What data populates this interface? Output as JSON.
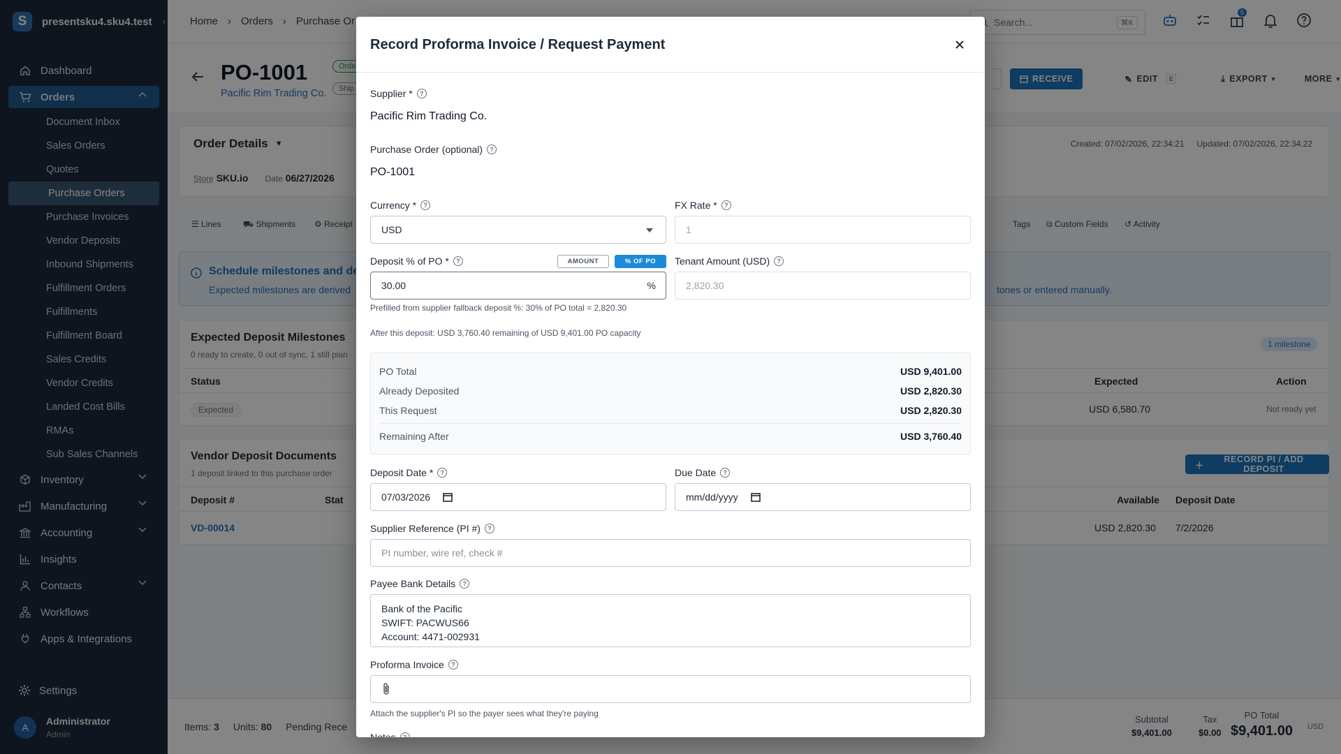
{
  "app": {
    "workspace": "presentsku4.sku4.test"
  },
  "sidebar": {
    "items": [
      {
        "label": "Dashboard"
      },
      {
        "label": "Orders"
      },
      {
        "label": "Inventory"
      },
      {
        "label": "Manufacturing"
      },
      {
        "label": "Accounting"
      },
      {
        "label": "Insights"
      },
      {
        "label": "Contacts"
      },
      {
        "label": "Workflows"
      },
      {
        "label": "Apps & Integrations"
      }
    ],
    "orders_sub": [
      "Document Inbox",
      "Sales Orders",
      "Quotes",
      "Purchase Orders",
      "Purchase Invoices",
      "Vendor Deposits",
      "Inbound Shipments",
      "Fulfillment Orders",
      "Fulfillments",
      "Fulfillment Board",
      "Sales Credits",
      "Vendor Credits",
      "Landed Cost Bills",
      "RMAs",
      "Sub Sales Channels"
    ],
    "settings": "Settings",
    "user": {
      "initial": "A",
      "name": "Administrator",
      "role": "Admin"
    }
  },
  "topbar": {
    "breadcrumbs": [
      "Home",
      "Orders",
      "Purchase Or"
    ],
    "search_placeholder": "Search...",
    "search_shortcut": "⌘K",
    "gift_badge": "5"
  },
  "page": {
    "title": "PO-1001",
    "supplier_link": "Pacific Rim Trading Co.",
    "status_chips": [
      "Orde",
      "Ship"
    ],
    "actions": {
      "receive": "RECEIVE",
      "edit": "EDIT",
      "edit_key": "E",
      "export": "EXPORT",
      "more": "MORE"
    },
    "order_details": {
      "heading": "Order Details",
      "created": "Created: 07/02/2026, 22:34:21",
      "updated": "Updated: 07/02/2026, 22:34:22",
      "store_label": "Store",
      "store_value": "SKU.io",
      "date_label": "Date",
      "date_value": "06/27/2026"
    },
    "tabs": [
      "Lines",
      "Shipments",
      "Receipt",
      "Tags",
      "Custom Fields",
      "Activity"
    ],
    "banner": {
      "title": "Schedule milestones and dep",
      "text": "Expected milestones are derived",
      "text_right": "tones or entered manually."
    },
    "milestones": {
      "heading": "Expected Deposit Milestones",
      "sub": "0 ready to create, 0 out of sync, 1 still plan",
      "badge": "1 milestone",
      "col_status": "Status",
      "col_expected": "Expected",
      "col_action": "Action",
      "row_status": "Expected",
      "row_expected": "USD 6,580.70",
      "row_action": "Not ready yet"
    },
    "deposits": {
      "heading": "Vendor Deposit Documents",
      "sub": "1 deposit linked to this purchase order",
      "button": "RECORD PI / ADD DEPOSIT",
      "col_number": "Deposit #",
      "col_status": "Stat",
      "col_available": "Available",
      "col_date": "Deposit Date",
      "row_number": "VD-00014",
      "row_available": "USD 2,820.30",
      "row_date": "7/2/2026"
    },
    "footer": {
      "items_label": "Items:",
      "items_value": "3",
      "units_label": "Units:",
      "units_value": "80",
      "pending_label": "Pending Rece",
      "subtotal_label": "Subtotal",
      "subtotal_value": "$9,401.00",
      "tax_label": "Tax",
      "tax_value": "$0.00",
      "po_total_label": "PO Total",
      "po_total_value": "$9,401.00",
      "currency": "USD"
    }
  },
  "modal": {
    "title": "Record Proforma Invoice / Request Payment",
    "supplier_label": "Supplier *",
    "supplier_value": "Pacific Rim Trading Co.",
    "po_label": "Purchase Order (optional)",
    "po_value": "PO-1001",
    "currency_label": "Currency *",
    "currency_value": "USD",
    "fx_label": "FX Rate *",
    "fx_value": "1",
    "deposit_label": "Deposit % of PO *",
    "toggle_amount": "AMOUNT",
    "toggle_percent": "% OF PO",
    "deposit_value": "30.00",
    "deposit_suffix": "%",
    "tenant_label": "Tenant Amount (USD)",
    "tenant_value": "2,820.30",
    "prefill_hint": "Prefilled from supplier fallback deposit %: 30% of PO total = 2,820.30",
    "after_hint": "After this deposit: USD 3,760.40 remaining of USD 9,401.00 PO capacity",
    "summary": [
      {
        "label": "PO Total",
        "value": "USD 9,401.00"
      },
      {
        "label": "Already Deposited",
        "value": "USD 2,820.30"
      },
      {
        "label": "This Request",
        "value": "USD 2,820.30"
      },
      {
        "label": "Remaining After",
        "value": "USD 3,760.40"
      }
    ],
    "deposit_date_label": "Deposit Date *",
    "deposit_date_value": "07/03/2026",
    "due_date_label": "Due Date",
    "due_date_value": "mm/dd/yyyy",
    "supref_label": "Supplier Reference (PI #)",
    "supref_placeholder": "PI number, wire ref, check #",
    "bank_label": "Payee Bank Details",
    "bank_value": "Bank of the Pacific\nSWIFT: PACWUS66\nAccount: 4471-002931\nBeneficiary: Pacific Rim Trading Co.",
    "pi_label": "Proforma Invoice",
    "pi_hint": "Attach the supplier's PI so the payer sees what they're paying",
    "notes_label": "Notes"
  },
  "colors": {
    "sidebar": "#1e2a3a",
    "accent": "#1c74bd",
    "active_nav": "#1d5a91",
    "active_sub": "#3a5674"
  }
}
